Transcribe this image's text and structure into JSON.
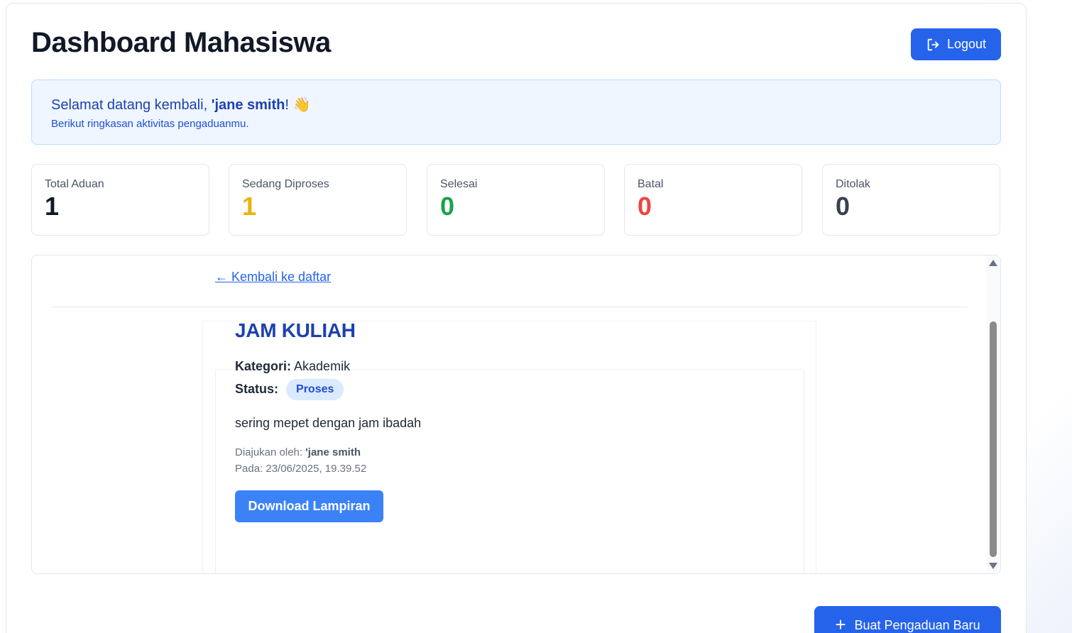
{
  "header": {
    "title": "Dashboard Mahasiswa",
    "logout_label": "Logout"
  },
  "welcome": {
    "greeting_prefix": "Selamat datang kembali, ",
    "user_name": "'jane smith",
    "greeting_suffix": "! 👋",
    "subtitle": "Berikut ringkasan aktivitas pengaduanmu."
  },
  "stats": [
    {
      "label": "Total Aduan",
      "value": "1",
      "color": "#111827"
    },
    {
      "label": "Sedang Diproses",
      "value": "1",
      "color": "#eab308"
    },
    {
      "label": "Selesai",
      "value": "0",
      "color": "#16a34a"
    },
    {
      "label": "Batal",
      "value": "0",
      "color": "#ef4444"
    },
    {
      "label": "Ditolak",
      "value": "0",
      "color": "#374151"
    }
  ],
  "detail": {
    "back_link": "← Kembali ke daftar",
    "title": "JAM KULIAH",
    "category_label": "Kategori:",
    "category": "Akademik",
    "status_label": "Status:",
    "status": "Proses",
    "description": "sering mepet dengan jam ibadah",
    "submitted_by_label": "Diajukan oleh: ",
    "submitted_by": "'jane smith",
    "date_line": "Pada: 23/06/2025, 19.39.52",
    "download_label": "Download Lampiran"
  },
  "actions": {
    "new_complaint_label": "Buat Pengaduan Baru",
    "new_complaint_icon": "plus-icon",
    "logout_icon": "logout-icon"
  },
  "colors": {
    "primary": "#2563eb",
    "download": "#3b82f6",
    "title_blue": "#1e40af"
  }
}
